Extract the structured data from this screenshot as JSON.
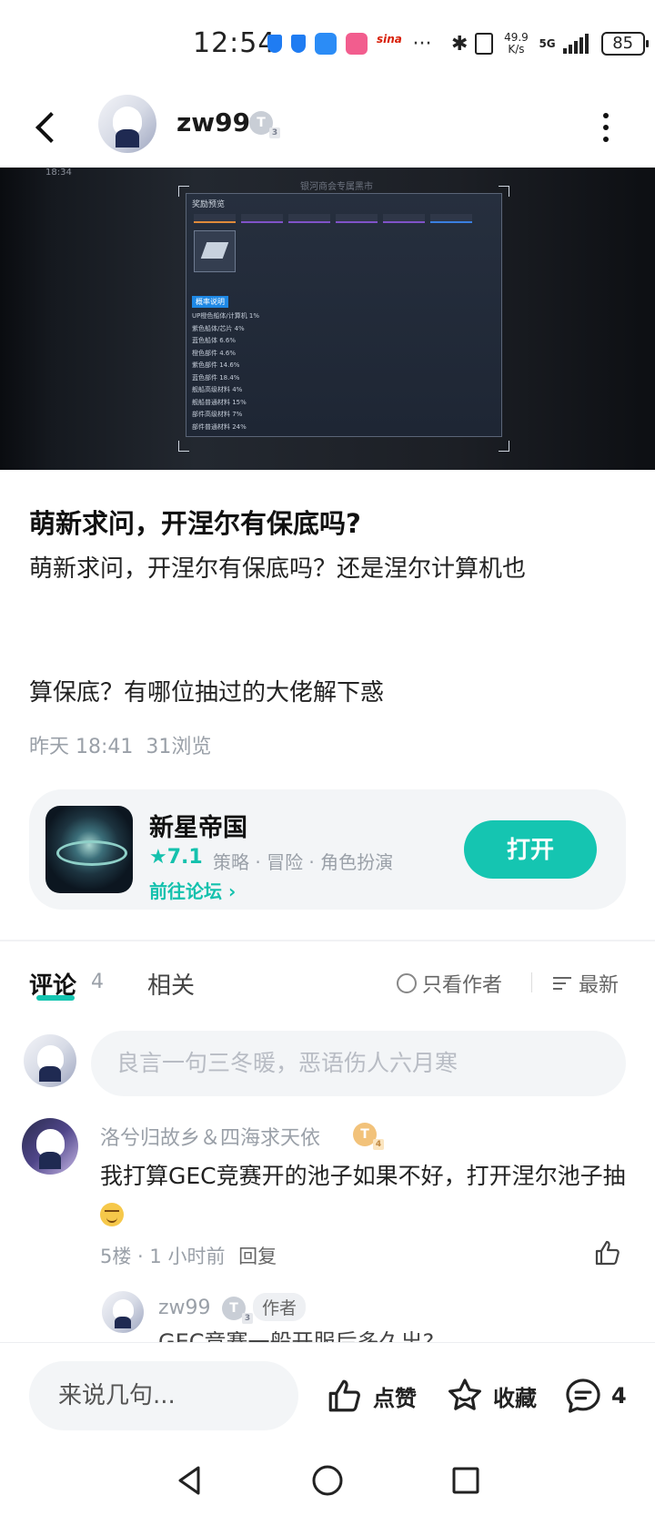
{
  "status_bar": {
    "time": "12:54",
    "icons": [
      "shield-icon",
      "shield-icon",
      "message-icon",
      "bilibili-icon",
      "sina-icon"
    ],
    "sina_label": "sina",
    "more": "···",
    "net_speed_value": "49.9",
    "net_speed_unit": "K/s",
    "network": "5G",
    "battery": "85"
  },
  "header": {
    "username": "zw99",
    "level_badge": "T",
    "level_sub": "3"
  },
  "hero_image": {
    "timestamp": "18:34",
    "banner": "银河商会专属黑市",
    "panel_title": "奖励预览",
    "rate_tag": "概率说明",
    "rates": [
      "UP橙色船体/计算机  1%",
      "紫色船体/芯片   4%",
      "蓝色船体   6.6%",
      "橙色部件   4.6%",
      "紫色部件   14.6%",
      "蓝色部件   18.4%",
      "舰船高级材料   4%",
      "舰船普通材料   15%",
      "部件高级材料   7%",
      "部件普通材料   24%"
    ]
  },
  "post": {
    "title": "萌新求问，开涅尔有保底吗?",
    "body_line1": "萌新求问，开涅尔有保底吗？还是涅尔计算机也",
    "body_line2": "算保底？有哪位抽过的大佬解下惑",
    "time": "昨天 18:41",
    "views": "31浏览"
  },
  "game_card": {
    "name": "新星帝国",
    "score": "★7.1",
    "tags": "策略 · 冒险 · 角色扮演",
    "forum_link": "前往论坛 ›",
    "open_label": "打开"
  },
  "comment_tabs": {
    "comments_label": "评论",
    "comments_count": "4",
    "related_label": "相关",
    "only_author_label": "只看作者",
    "sort_label": "最新"
  },
  "comment_input": {
    "placeholder": "良言一句三冬暖，恶语伤人六月寒"
  },
  "comments": [
    {
      "author": "洛兮归故乡＆四海求天依",
      "badge": "T",
      "badge_sub": "4",
      "text": "我打算GEC竞赛开的池子如果不好，打开涅尔池子抽",
      "floor": "5楼",
      "time": "1 小时前",
      "reply_label": "回复",
      "reply_preview": {
        "author": "zw99",
        "badge": "T",
        "badge_sub": "3",
        "author_tag": "作者",
        "text": "GEC竞赛一般开服后多久出?"
      }
    }
  ],
  "bottom_bar": {
    "input_placeholder": "来说几句...",
    "like_label": "点赞",
    "favorite_label": "收藏",
    "comment_count": "4"
  }
}
